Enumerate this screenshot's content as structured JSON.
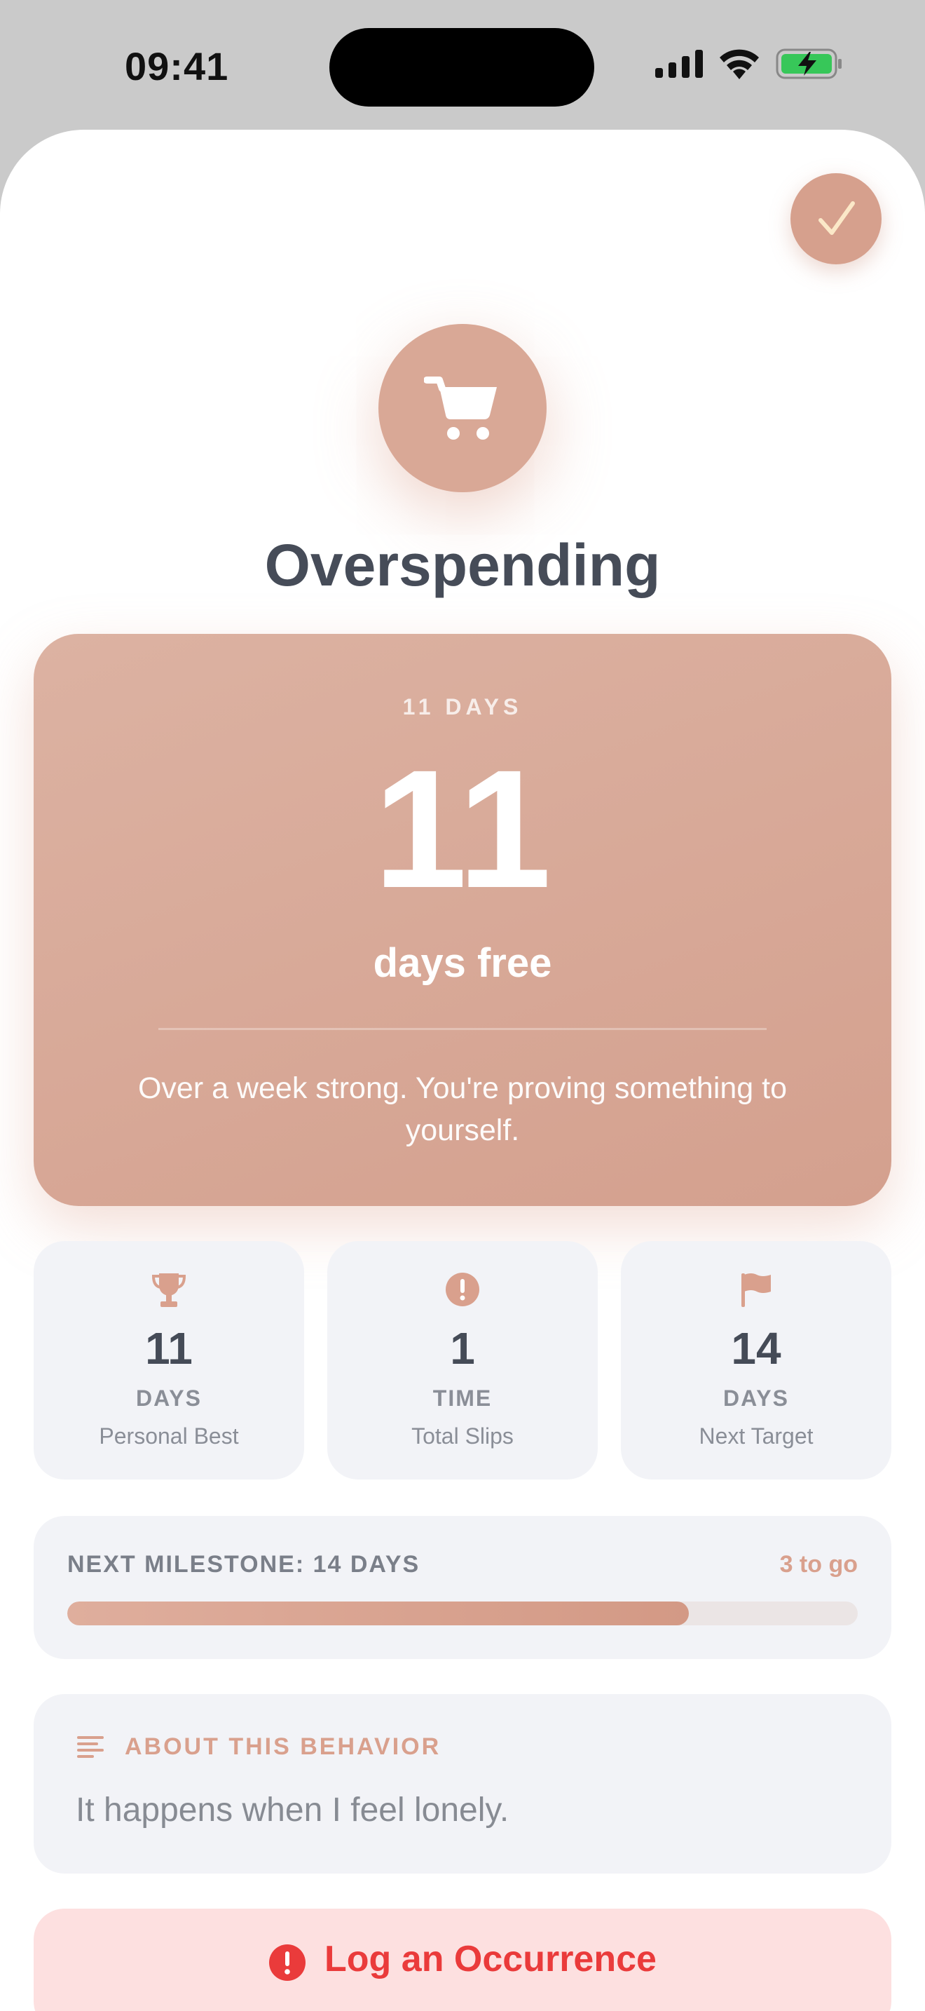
{
  "status_bar": {
    "time": "09:41"
  },
  "habit": {
    "icon": "cart-icon",
    "title": "Overspending"
  },
  "hero": {
    "eyebrow": "11 DAYS",
    "number": "11",
    "unit": "days free",
    "message": "Over a week strong. You're proving something to yourself."
  },
  "stats": [
    {
      "icon": "trophy-icon",
      "value": "11",
      "unit": "DAYS",
      "label": "Personal Best"
    },
    {
      "icon": "exclamation-circle-icon",
      "value": "1",
      "unit": "TIME",
      "label": "Total Slips"
    },
    {
      "icon": "flag-icon",
      "value": "14",
      "unit": "DAYS",
      "label": "Next Target"
    }
  ],
  "milestone": {
    "label": "NEXT MILESTONE: 14 DAYS",
    "remaining": "3 to go",
    "progress": 0.786
  },
  "about": {
    "icon": "text-lines-icon",
    "title": "ABOUT THIS BEHAVIOR",
    "text": "It happens when I feel lonely."
  },
  "log_button": {
    "icon": "exclamation-circle-icon",
    "label": "Log an Occurrence"
  },
  "colors": {
    "accent": "#d6a08d",
    "danger": "#ea3b3b",
    "card_bg": "#f2f3f7",
    "title_text": "#464c58"
  }
}
